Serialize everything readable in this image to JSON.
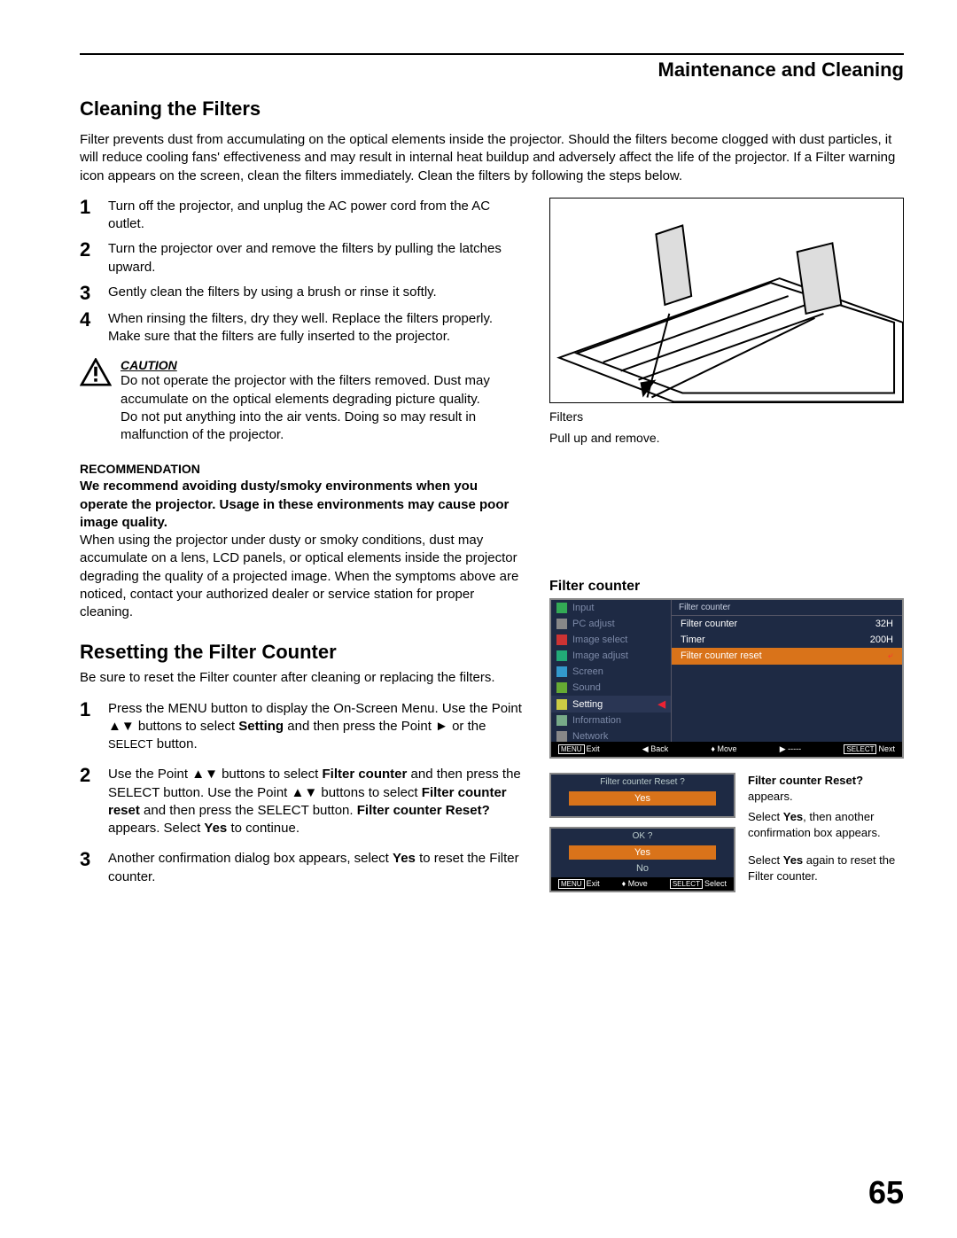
{
  "header": "Maintenance and Cleaning",
  "section1_title": "Cleaning the Filters",
  "intro": "Filter prevents dust from accumulating on the optical elements inside the projector. Should the filters become clogged with dust particles, it will reduce cooling fans' effectiveness and may result in internal heat buildup and adversely affect the life of the projector. If a Filter warning icon appears on the screen, clean the filters immediately. Clean the filters by following the steps below.",
  "steps1": [
    "Turn off the projector, and unplug the AC power cord from the AC outlet.",
    "Turn the projector over and remove the filters by pulling the latches upward.",
    "Gently clean the filters by using a brush or rinse it softly.",
    "When rinsing the filters, dry they well. Replace the filters properly. Make sure that the filters are fully inserted to the projector."
  ],
  "caution_title": "CAUTION",
  "caution_text1": "Do not operate the projector with the filters removed. Dust may accumulate on the optical elements degrading picture quality.",
  "caution_text2": "Do not put anything into the air vents. Doing so may result in malfunction of the projector.",
  "reco_title": "RECOMMENDATION",
  "reco_bold": "We recommend avoiding dusty/smoky environments when you operate the projector. Usage in these environments may cause poor image quality.",
  "reco_text": "When using the projector under dusty or smoky conditions, dust may accumulate on a lens, LCD panels, or optical elements inside the projector degrading the quality of a projected image. When the symptoms above are noticed, contact your authorized dealer or service station for proper cleaning.",
  "section2_title": "Resetting the Filter Counter",
  "section2_intro": "Be sure to reset the Filter counter after cleaning or replacing the filters.",
  "steps2_1_a": "Press the MENU button to display the On-Screen Menu. Use the Point ▲▼ buttons to select ",
  "steps2_1_b": "Setting",
  "steps2_1_c": " and then press the Point ► or the ",
  "steps2_1_d": "SELECT",
  "steps2_1_e": " button.",
  "steps2_2_a": "Use the Point ▲▼ buttons to select ",
  "steps2_2_b": "Filter counter",
  "steps2_2_c": " and then press the SELECT button. Use the Point ▲▼ buttons to select ",
  "steps2_2_d": "Filter counter reset",
  "steps2_2_e": " and then press the SELECT button. ",
  "steps2_2_f": "Filter counter Reset?",
  "steps2_2_g": " appears. Select ",
  "steps2_2_h": "Yes",
  "steps2_2_i": " to continue.",
  "steps2_3_a": "Another confirmation dialog box appears, select ",
  "steps2_3_b": "Yes",
  "steps2_3_c": " to reset the Filter counter.",
  "fig1_label1": "Filters",
  "fig1_label2": "Pull up and remove.",
  "filter_counter_heading": "Filter counter",
  "osd_header": "Filter counter",
  "osd_menu": [
    "Input",
    "PC adjust",
    "Image select",
    "Image adjust",
    "Screen",
    "Sound",
    "Setting",
    "Information",
    "Network"
  ],
  "osd_rows": [
    {
      "label": "Filter counter",
      "value": "32H"
    },
    {
      "label": "Timer",
      "value": "200H"
    },
    {
      "label": "Filter counter reset",
      "value": "⤶",
      "hl": true
    }
  ],
  "osd_footer": {
    "exit": "Exit",
    "back": "Back",
    "move": "Move",
    "fwd": "-----",
    "next": "Next"
  },
  "dlg1_title": "Filter counter  Reset ?",
  "dlg1_yes": "Yes",
  "dlg2_title": "OK ?",
  "dlg2_yes": "Yes",
  "dlg2_no": "No",
  "dlg_foot_exit": "Exit",
  "dlg_foot_move": "Move",
  "dlg_foot_select": "Select",
  "dlg_text_title": "Filter counter Reset?",
  "dlg_text_1": " appears.",
  "dlg_text_2a": "Select ",
  "dlg_text_2b": "Yes",
  "dlg_text_2c": ", then another confirmation box appears.",
  "dlg_text_3a": "Select ",
  "dlg_text_3b": "Yes",
  "dlg_text_3c": " again to reset the Filter counter.",
  "page_number": "65"
}
